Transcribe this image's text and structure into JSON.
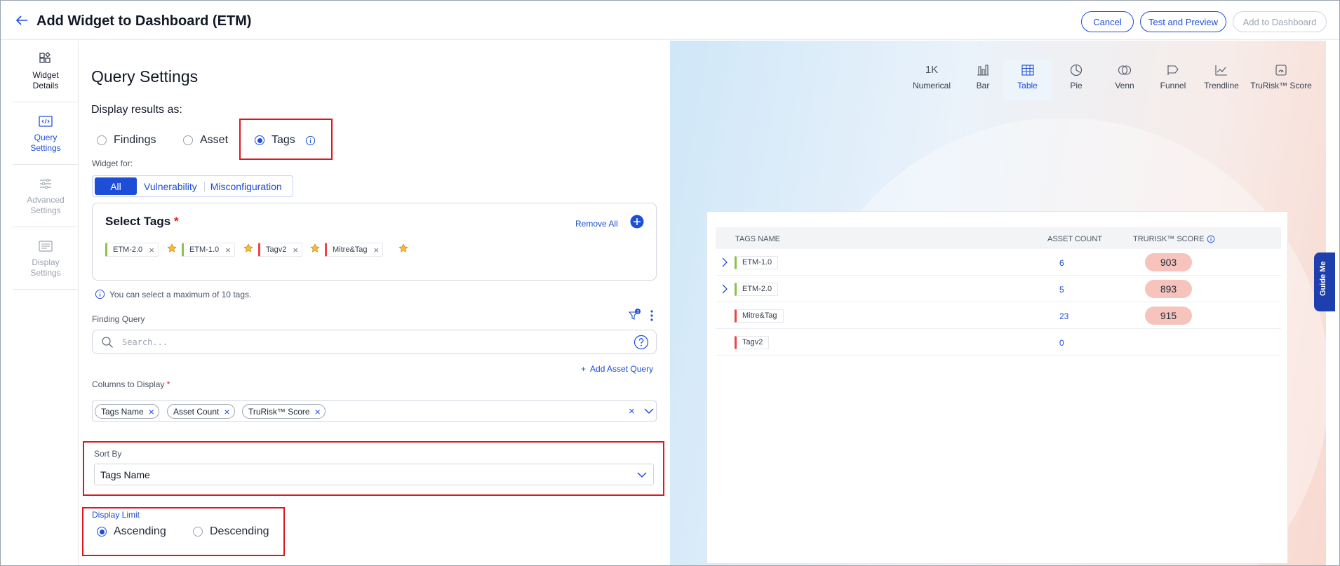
{
  "header": {
    "title": "Add Widget to Dashboard (ETM)",
    "cancel_label": "Cancel",
    "test_label": "Test and Preview",
    "add_label": "Add to Dashboard"
  },
  "sidebar": {
    "items": [
      {
        "label_1": "Widget",
        "label_2": "Details"
      },
      {
        "label_1": "Query",
        "label_2": "Settings"
      },
      {
        "label_1": "Advanced",
        "label_2": "Settings"
      },
      {
        "label_1": "Display",
        "label_2": "Settings"
      }
    ]
  },
  "query": {
    "title": "Query Settings",
    "display_results_label": "Display results as:",
    "options": [
      "Findings",
      "Asset",
      "Tags"
    ],
    "selected": "Tags",
    "widget_for_label": "Widget for:",
    "widget_for_options": [
      "All",
      "Vulnerability",
      "Misconfiguration"
    ],
    "widget_for_selected": "All",
    "select_tags_title": "Select Tags",
    "required_mark": "*",
    "remove_all": "Remove All",
    "tags": [
      {
        "name": "ETM-2.0",
        "color": "#8bc34a"
      },
      {
        "name": "ETM-1.0",
        "color": "#8bc34a"
      },
      {
        "name": "Tagv2",
        "color": "#ef4444"
      },
      {
        "name": "Mitre&Tag",
        "color": "#ef4444"
      }
    ],
    "max_note": "You can select a maximum of 10 tags.",
    "finding_query_label": "Finding Query",
    "filter_count": "3",
    "search_placeholder": "Search...",
    "add_asset_query": "Add Asset Query",
    "columns_label": "Columns to Display",
    "columns": [
      "Tags Name",
      "Asset Count",
      "TruRisk™ Score"
    ],
    "sort_by_label": "Sort By",
    "sort_by_value": "Tags Name",
    "display_limit_label": "Display Limit",
    "order_options": [
      "Ascending",
      "Descending"
    ],
    "order_selected": "Ascending"
  },
  "preview": {
    "viz_tabs": [
      {
        "label": "Numerical",
        "icon_text": "1K"
      },
      {
        "label": "Bar"
      },
      {
        "label": "Table"
      },
      {
        "label": "Pie"
      },
      {
        "label": "Venn"
      },
      {
        "label": "Funnel"
      },
      {
        "label": "Trendline"
      },
      {
        "label": "TruRisk™ Score"
      }
    ],
    "active_tab": "Table",
    "table": {
      "headers": [
        "TAGS NAME",
        "ASSET COUNT",
        "TRURISK™ SCORE"
      ],
      "rows": [
        {
          "name": "ETM-1.0",
          "color": "#8bc34a",
          "count": "6",
          "score": "903",
          "expandable": true
        },
        {
          "name": "ETM-2.0",
          "color": "#8bc34a",
          "count": "5",
          "score": "893",
          "expandable": true
        },
        {
          "name": "Mitre&Tag",
          "color": "#ef4444",
          "count": "23",
          "score": "915",
          "expandable": false
        },
        {
          "name": "Tagv2",
          "color": "#ef4444",
          "count": "0",
          "score": "",
          "expandable": false
        }
      ]
    },
    "guide_me": "Guide Me"
  },
  "colors": {
    "accent": "#1d4ed8",
    "highlight_border": "#e0161e",
    "score_pill": "#f7c4bd"
  }
}
